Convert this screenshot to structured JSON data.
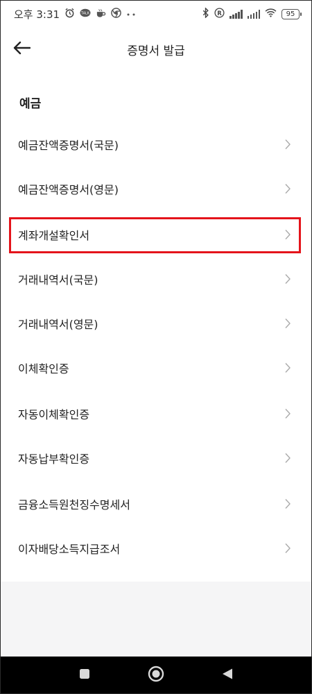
{
  "status_bar": {
    "time": "오후 3:31",
    "battery": "95",
    "left_icons": [
      "alarm-icon",
      "kakao-icon",
      "coffee-icon",
      "chrome-icon",
      "more-dots-icon"
    ],
    "right_icons": [
      "bluetooth-icon",
      "registered-icon",
      "signal-icon",
      "signal-icon",
      "wifi-icon",
      "battery-icon"
    ]
  },
  "header": {
    "title": "증명서 발급",
    "back_icon": "back-arrow-icon"
  },
  "section": {
    "title": "예금"
  },
  "menu": {
    "items": [
      {
        "label": "예금잔액증명서(국문)"
      },
      {
        "label": "예금잔액증명서(영문)"
      },
      {
        "label": "계좌개설확인서",
        "highlighted": true
      },
      {
        "label": "거래내역서(국문)"
      },
      {
        "label": "거래내역서(영문)"
      },
      {
        "label": "이체확인증"
      },
      {
        "label": "자동이체확인증"
      },
      {
        "label": "자동납부확인증"
      },
      {
        "label": "금융소득원천징수명세서"
      },
      {
        "label": "이자배당소득지급조서"
      }
    ]
  },
  "colors": {
    "highlight": "#e4141b",
    "navbar": "#000000",
    "footer_band": "#f5f5f6"
  },
  "nav": {
    "icons": [
      "recents-square-icon",
      "home-circle-icon",
      "back-triangle-icon"
    ]
  }
}
